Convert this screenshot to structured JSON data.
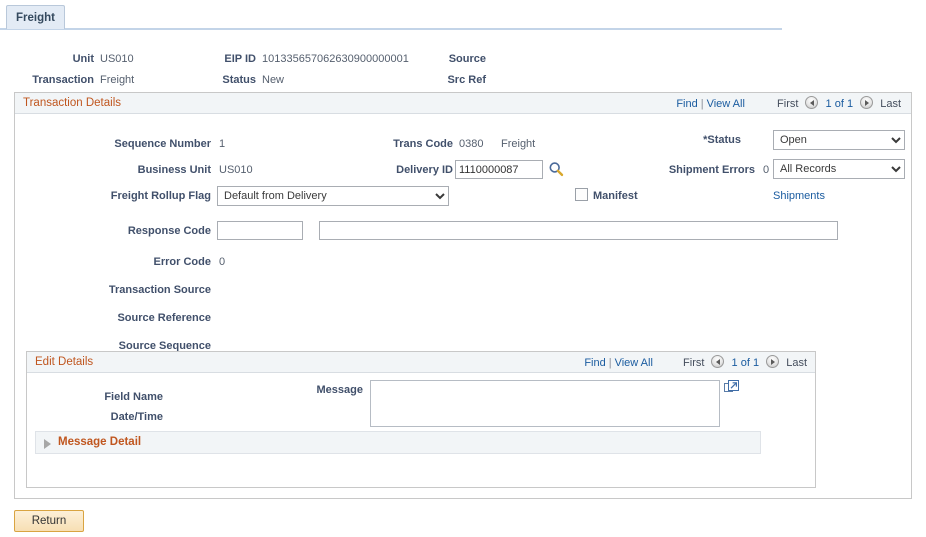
{
  "tab": {
    "label": "Freight"
  },
  "summary": {
    "unit_label": "Unit",
    "unit_value": "US010",
    "transaction_label": "Transaction",
    "transaction_value": "Freight",
    "eip_id_label": "EIP ID",
    "eip_id_value": "101335657062630900000001",
    "status_label": "Status",
    "status_value": "New",
    "source_label": "Source",
    "source_value": "",
    "src_ref_label": "Src Ref",
    "src_ref_value": ""
  },
  "transaction_details": {
    "title": "Transaction Details",
    "nav": {
      "find": "Find",
      "separator": "|",
      "view_all": "View All",
      "first": "First",
      "counter": "1 of 1",
      "last": "Last"
    },
    "sequence_number_label": "Sequence Number",
    "sequence_number_value": "1",
    "business_unit_label": "Business Unit",
    "business_unit_value": "US010",
    "freight_rollup_flag_label": "Freight Rollup Flag",
    "freight_rollup_flag_value": "Default from Delivery",
    "response_code_label": "Response Code",
    "response_code_value": "",
    "response_code_placeholder": "",
    "response_text_value": "",
    "response_text_placeholder": "",
    "error_code_label": "Error Code",
    "error_code_value": "0",
    "transaction_source_label": "Transaction Source",
    "transaction_source_value": "",
    "source_reference_label": "Source Reference",
    "source_reference_value": "",
    "source_sequence_label": "Source Sequence",
    "source_sequence_value": "",
    "trans_code_label": "Trans Code",
    "trans_code_value": "0380",
    "trans_code_desc": "Freight",
    "delivery_id_label": "Delivery ID",
    "delivery_id_value": "1110000087",
    "delivery_id_placeholder": "",
    "manifest_label": "Manifest",
    "manifest_checked": false,
    "status_label": "*Status",
    "status_value": "Open",
    "status_options": [
      "Open"
    ],
    "shipment_errors_label": "Shipment Errors",
    "shipment_errors_value": "0",
    "records_filter_value": "All Records",
    "records_filter_options": [
      "All Records"
    ],
    "shipments_link": "Shipments"
  },
  "edit_details": {
    "title": "Edit Details",
    "nav": {
      "find": "Find",
      "separator": "|",
      "view_all": "View All",
      "first": "First",
      "counter": "1 of 1",
      "last": "Last"
    },
    "field_name_label": "Field Name",
    "field_name_value": "",
    "date_time_label": "Date/Time",
    "date_time_value": "",
    "message_label": "Message",
    "message_value": "",
    "message_placeholder": "",
    "message_detail_label": "Message Detail"
  },
  "footer": {
    "return_label": "Return"
  },
  "colors": {
    "section_title": "#c0561f",
    "link": "#1b5ca0",
    "label": "#41506b",
    "value": "#555f6e",
    "panel_header_bg": "#f2f5f7",
    "tab_bg": "#e3ebf5",
    "button_border": "#d9a441"
  }
}
